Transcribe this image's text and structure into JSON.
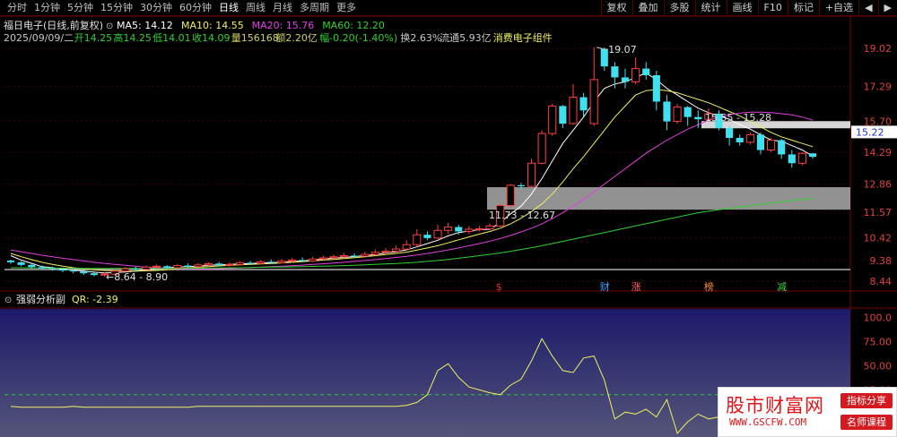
{
  "periods": [
    "分时",
    "1分钟",
    "5分钟",
    "15分钟",
    "30分钟",
    "60分钟",
    "日线",
    "周线",
    "月线",
    "多周期",
    "更多"
  ],
  "active_period": "日线",
  "right_buttons": [
    "复权",
    "叠加",
    "多股",
    "统计",
    "画线",
    "F10",
    "标记",
    "+自选",
    "◀",
    "▶"
  ],
  "stock": {
    "title": "福日电子(日线,前复权)",
    "ma_legend": [
      {
        "label": "MA5: 14.12",
        "color": "#ffffff"
      },
      {
        "label": "MA10: 14.55",
        "color": "#f0f060"
      },
      {
        "label": "MA20: 15.76",
        "color": "#e040e0"
      },
      {
        "label": "MA60: 12.20",
        "color": "#30d030"
      }
    ],
    "info_line": [
      {
        "text": "2025/09/09/二",
        "color": "#c8c8c8"
      },
      {
        "text": "开14.25",
        "color": "#30d030"
      },
      {
        "text": "高14.25",
        "color": "#30d030"
      },
      {
        "text": "低14.01",
        "color": "#30d030"
      },
      {
        "text": "收14.09",
        "color": "#30d030"
      },
      {
        "text": "量156168",
        "color": "#d0d060"
      },
      {
        "text": "额2.20亿",
        "color": "#d0d060"
      },
      {
        "text": "幅-0.20(-1.40%)",
        "color": "#30d030"
      },
      {
        "text": "换2.63%",
        "color": "#c8c8c8"
      },
      {
        "text": "流通5.93亿",
        "color": "#c8c8c8"
      },
      {
        "text": "消费电子组件",
        "color": "#f0f060"
      }
    ]
  },
  "price_axis": {
    "labels": [
      "19.02",
      "17.29",
      "15.70",
      "14.29",
      "12.86",
      "11.57",
      "10.42",
      "9.38",
      "8.44"
    ],
    "current": "15.22"
  },
  "annotations": {
    "high": "19.07",
    "low": "8.64 - 8.90",
    "band_upper": "15.55 - 15.28",
    "band_lower": "11.73 - 12.67"
  },
  "event_markers": [
    {
      "text": "$",
      "color": "#e03030"
    },
    {
      "text": "财",
      "color": "#40a0ff"
    },
    {
      "text": "涨",
      "color": "#ff6060"
    },
    {
      "text": "榜",
      "color": "#ff9030"
    },
    {
      "text": "减",
      "color": "#40d040"
    }
  ],
  "indicator": {
    "title": "强弱分析副",
    "qr_label": "QR: -2.39",
    "axis_labels": [
      "100.0",
      "75.00",
      "50.00",
      "25.00"
    ],
    "dashed_label": "20"
  },
  "watermark": {
    "site": "股市财富网",
    "url": "WWW.GSCFW.COM",
    "tag1": "指标分享",
    "tag2": "名师课程"
  },
  "chart_data": {
    "type": "candlestick",
    "candles": [
      [
        9.38,
        9.3,
        9.42,
        9.22
      ],
      [
        9.3,
        9.18,
        9.35,
        9.12
      ],
      [
        9.18,
        9.08,
        9.25,
        9.02
      ],
      [
        9.08,
        9.02,
        9.15,
        8.96
      ],
      [
        9.02,
        8.98,
        9.1,
        8.92
      ],
      [
        8.98,
        8.92,
        9.05,
        8.85
      ],
      [
        8.92,
        8.88,
        9.0,
        8.8
      ],
      [
        8.88,
        8.8,
        8.95,
        8.72
      ],
      [
        8.8,
        8.72,
        8.9,
        8.66
      ],
      [
        8.72,
        8.76,
        8.85,
        8.64
      ],
      [
        8.76,
        8.9,
        8.98,
        8.7
      ],
      [
        8.9,
        9.0,
        9.08,
        8.86
      ],
      [
        9.0,
        8.98,
        9.1,
        8.92
      ],
      [
        8.98,
        9.08,
        9.15,
        8.94
      ],
      [
        9.08,
        9.12,
        9.2,
        9.02
      ],
      [
        9.12,
        9.05,
        9.18,
        9.0
      ],
      [
        9.05,
        9.15,
        9.22,
        9.02
      ],
      [
        9.15,
        9.1,
        9.25,
        9.05
      ],
      [
        9.1,
        9.18,
        9.26,
        9.05
      ],
      [
        9.18,
        9.24,
        9.3,
        9.1
      ],
      [
        9.24,
        9.16,
        9.32,
        9.12
      ],
      [
        9.16,
        9.2,
        9.28,
        9.1
      ],
      [
        9.2,
        9.28,
        9.35,
        9.15
      ],
      [
        9.28,
        9.25,
        9.36,
        9.18
      ],
      [
        9.25,
        9.32,
        9.4,
        9.2
      ],
      [
        9.32,
        9.28,
        9.42,
        9.22
      ],
      [
        9.28,
        9.35,
        9.45,
        9.25
      ],
      [
        9.35,
        9.4,
        9.5,
        9.3
      ],
      [
        9.4,
        9.36,
        9.52,
        9.3
      ],
      [
        9.36,
        9.45,
        9.55,
        9.32
      ],
      [
        9.45,
        9.5,
        9.6,
        9.4
      ],
      [
        9.5,
        9.55,
        9.65,
        9.45
      ],
      [
        9.55,
        9.6,
        9.72,
        9.5
      ],
      [
        9.6,
        9.58,
        9.7,
        9.52
      ],
      [
        9.58,
        9.66,
        9.78,
        9.55
      ],
      [
        9.66,
        9.75,
        9.88,
        9.6
      ],
      [
        9.75,
        9.8,
        9.95,
        9.7
      ],
      [
        9.8,
        9.9,
        10.05,
        9.75
      ],
      [
        9.9,
        10.1,
        10.3,
        9.85
      ],
      [
        10.1,
        10.55,
        10.8,
        10.0
      ],
      [
        10.55,
        10.4,
        10.7,
        10.3
      ],
      [
        10.4,
        10.75,
        11.0,
        10.35
      ],
      [
        10.75,
        10.9,
        11.1,
        10.6
      ],
      [
        10.9,
        10.7,
        11.0,
        10.55
      ],
      [
        10.7,
        10.8,
        10.95,
        10.6
      ],
      [
        10.8,
        10.82,
        10.95,
        10.7
      ],
      [
        10.82,
        10.95,
        11.05,
        10.75
      ],
      [
        10.95,
        11.88,
        11.95,
        10.9
      ],
      [
        11.88,
        12.8,
        12.85,
        11.8
      ],
      [
        12.8,
        12.75,
        12.9,
        12.6
      ],
      [
        12.75,
        13.8,
        14.0,
        12.7
      ],
      [
        13.8,
        15.15,
        15.3,
        13.75
      ],
      [
        15.15,
        16.4,
        16.5,
        15.05
      ],
      [
        16.4,
        15.6,
        16.45,
        15.4
      ],
      [
        15.6,
        16.8,
        17.4,
        15.55
      ],
      [
        16.8,
        16.2,
        17.0,
        15.9
      ],
      [
        15.6,
        17.6,
        19.07,
        15.5
      ],
      [
        19.0,
        18.2,
        19.07,
        18.0
      ],
      [
        18.2,
        17.7,
        18.4,
        17.2
      ],
      [
        17.7,
        17.5,
        18.1,
        17.2
      ],
      [
        17.5,
        18.1,
        18.6,
        17.4
      ],
      [
        18.1,
        17.8,
        18.4,
        17.6
      ],
      [
        17.8,
        16.6,
        18.0,
        16.2
      ],
      [
        16.6,
        15.7,
        16.9,
        15.3
      ],
      [
        15.7,
        16.35,
        16.5,
        15.6
      ],
      [
        16.35,
        15.9,
        16.4,
        15.5
      ],
      [
        15.9,
        15.8,
        16.2,
        15.4
      ],
      [
        15.8,
        16.05,
        16.3,
        15.7
      ],
      [
        16.05,
        15.4,
        16.2,
        15.3
      ],
      [
        15.4,
        14.95,
        15.5,
        14.6
      ],
      [
        14.95,
        14.75,
        15.1,
        14.6
      ],
      [
        14.75,
        15.1,
        15.2,
        14.65
      ],
      [
        15.1,
        14.4,
        15.2,
        14.2
      ],
      [
        14.4,
        14.85,
        14.95,
        14.3
      ],
      [
        14.85,
        14.2,
        14.9,
        14.0
      ],
      [
        14.2,
        13.8,
        14.4,
        13.6
      ],
      [
        13.8,
        14.25,
        14.3,
        13.7
      ],
      [
        14.25,
        14.09,
        14.25,
        14.01
      ]
    ],
    "ma_series": {
      "MA5": [
        9.6,
        9.4,
        9.25,
        9.1,
        9.05,
        9.0,
        8.95,
        8.9,
        8.85,
        8.82,
        8.83,
        8.86,
        8.9,
        8.95,
        9.02,
        9.05,
        9.08,
        9.1,
        9.12,
        9.16,
        9.18,
        9.2,
        9.22,
        9.24,
        9.26,
        9.28,
        9.3,
        9.33,
        9.36,
        9.4,
        9.44,
        9.48,
        9.52,
        9.56,
        9.6,
        9.65,
        9.72,
        9.78,
        9.86,
        10.0,
        10.15,
        10.3,
        10.5,
        10.65,
        10.72,
        10.78,
        10.8,
        11.1,
        11.5,
        11.85,
        12.4,
        13.1,
        13.9,
        14.7,
        15.3,
        15.9,
        16.6,
        17.2,
        17.4,
        17.5,
        17.7,
        17.9,
        17.6,
        17.2,
        16.9,
        16.6,
        16.3,
        16.1,
        15.95,
        15.8,
        15.55,
        15.35,
        15.1,
        14.85,
        14.8,
        14.6,
        14.4,
        14.12
      ],
      "MA10": [
        9.7,
        9.55,
        9.42,
        9.3,
        9.2,
        9.12,
        9.05,
        9.0,
        8.96,
        8.93,
        8.91,
        8.9,
        8.9,
        8.91,
        8.93,
        8.96,
        9.0,
        9.04,
        9.07,
        9.1,
        9.13,
        9.16,
        9.18,
        9.2,
        9.22,
        9.24,
        9.27,
        9.3,
        9.33,
        9.36,
        9.4,
        9.43,
        9.47,
        9.51,
        9.55,
        9.6,
        9.65,
        9.7,
        9.76,
        9.85,
        9.95,
        10.05,
        10.18,
        10.32,
        10.45,
        10.58,
        10.7,
        10.85,
        11.05,
        11.3,
        11.6,
        11.95,
        12.4,
        12.95,
        13.55,
        14.1,
        14.7,
        15.3,
        15.9,
        16.4,
        16.9,
        17.1,
        17.15,
        17.1,
        17.0,
        16.85,
        16.7,
        16.55,
        16.35,
        16.15,
        15.95,
        15.7,
        15.45,
        15.2,
        15.0,
        14.85,
        14.7,
        14.55
      ],
      "MA20": [
        9.85,
        9.78,
        9.7,
        9.62,
        9.55,
        9.48,
        9.42,
        9.36,
        9.3,
        9.25,
        9.2,
        9.16,
        9.12,
        9.08,
        9.05,
        9.03,
        9.01,
        9.0,
        9.0,
        9.0,
        9.01,
        9.02,
        9.04,
        9.06,
        9.08,
        9.1,
        9.12,
        9.14,
        9.17,
        9.2,
        9.23,
        9.26,
        9.3,
        9.34,
        9.38,
        9.42,
        9.47,
        9.52,
        9.57,
        9.63,
        9.7,
        9.78,
        9.86,
        9.95,
        10.05,
        10.15,
        10.26,
        10.38,
        10.52,
        10.68,
        10.85,
        11.05,
        11.28,
        11.55,
        11.85,
        12.15,
        12.5,
        12.85,
        13.2,
        13.55,
        13.9,
        14.25,
        14.55,
        14.85,
        15.1,
        15.35,
        15.55,
        15.75,
        15.9,
        16.0,
        16.08,
        16.12,
        16.12,
        16.1,
        16.05,
        16.0,
        15.9,
        15.76
      ],
      "MA60": [
        9.05,
        9.05,
        9.04,
        9.04,
        9.03,
        9.03,
        9.02,
        9.02,
        9.02,
        9.02,
        9.02,
        9.02,
        9.02,
        9.02,
        9.02,
        9.02,
        9.02,
        9.03,
        9.03,
        9.04,
        9.04,
        9.05,
        9.05,
        9.06,
        9.07,
        9.08,
        9.08,
        9.09,
        9.1,
        9.11,
        9.12,
        9.13,
        9.15,
        9.16,
        9.18,
        9.2,
        9.22,
        9.24,
        9.27,
        9.3,
        9.34,
        9.38,
        9.43,
        9.48,
        9.54,
        9.6,
        9.66,
        9.72,
        9.8,
        9.88,
        9.96,
        10.05,
        10.15,
        10.25,
        10.35,
        10.45,
        10.55,
        10.65,
        10.75,
        10.85,
        10.95,
        11.05,
        11.15,
        11.25,
        11.35,
        11.45,
        11.55,
        11.62,
        11.69,
        11.75,
        11.81,
        11.87,
        11.93,
        11.99,
        12.05,
        12.1,
        12.15,
        12.2
      ]
    },
    "qr_series": [
      8,
      7,
      7,
      7,
      7,
      7,
      8,
      7,
      7,
      7,
      7,
      7,
      7,
      7,
      7,
      7,
      7,
      7,
      8,
      8,
      8,
      8,
      8,
      8,
      8,
      8,
      8,
      8,
      8,
      8,
      8,
      8,
      8,
      8,
      8,
      8,
      8,
      8,
      9,
      12,
      20,
      45,
      52,
      38,
      28,
      25,
      22,
      20,
      30,
      36,
      55,
      78,
      60,
      45,
      43,
      58,
      60,
      35,
      -5,
      2,
      0,
      5,
      -3,
      15,
      -20,
      -8,
      0,
      -5,
      -3,
      -4,
      -5,
      -3,
      -1,
      -2,
      0,
      -3,
      -2,
      -2.39
    ],
    "price_ticks": [
      19.02,
      17.29,
      15.7,
      14.29,
      12.86,
      11.57,
      10.42,
      9.38,
      8.44
    ],
    "indicator_ticks": [
      100,
      75,
      50,
      25
    ],
    "support_bands": [
      [
        15.55,
        15.28
      ],
      [
        11.73,
        12.67
      ]
    ],
    "qr_dashed_level": 20
  }
}
